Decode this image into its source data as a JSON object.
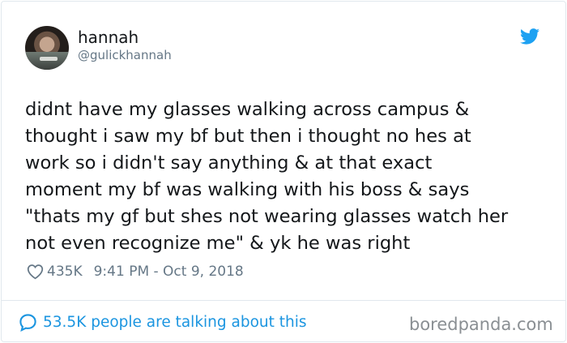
{
  "user": {
    "display_name": "hannah",
    "handle": "@gulickhannah"
  },
  "tweet": {
    "text": "didnt have my glasses walking across campus &\nthought i saw my bf but then i thought no hes at\nwork so i didn't say anything & at that exact\nmoment my bf was walking with his boss & says\n\"thats my gf but shes not wearing glasses watch her\nnot even recognize me\" & yk he was right",
    "likes": "435K",
    "timestamp": "9:41 PM - Oct 9, 2018"
  },
  "footer": {
    "talking_text": "53.5K people are talking about this",
    "watermark": "boredpanda.com"
  },
  "icons": {
    "brand": "twitter-bird-icon",
    "like": "heart-icon",
    "conversation": "speech-bubble-icon"
  },
  "colors": {
    "twitter_blue": "#1da1f2",
    "link_blue": "#1b95e0",
    "secondary_text": "#657786",
    "primary_text": "#14171a",
    "border": "#e1e8ed"
  }
}
